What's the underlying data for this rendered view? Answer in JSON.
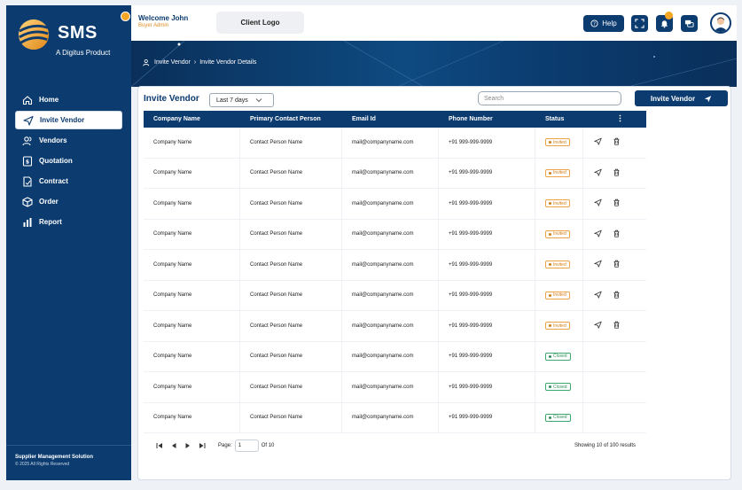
{
  "brand": {
    "title": "SMS",
    "subtitle": "A Digitus Product"
  },
  "sidebar": {
    "items": [
      {
        "label": "Home",
        "icon": "home-icon",
        "active": false
      },
      {
        "label": "Invite Vendor",
        "icon": "send-icon",
        "active": true
      },
      {
        "label": "Vendors",
        "icon": "users-icon",
        "active": false
      },
      {
        "label": "Quotation",
        "icon": "quotation-icon",
        "active": false
      },
      {
        "label": "Contract",
        "icon": "contract-icon",
        "active": false
      },
      {
        "label": "Order",
        "icon": "box-icon",
        "active": false
      },
      {
        "label": "Report",
        "icon": "chart-icon",
        "active": false
      }
    ],
    "footer_title": "Supplier Management Solution",
    "footer_copy": "© 2025 All Rights Reserved"
  },
  "topbar": {
    "welcome": "Welcome John",
    "role": "Buyer Admin",
    "client_logo": "Client Logo",
    "help_label": "Help"
  },
  "breadcrumb": {
    "item1": "Invite Vendor",
    "item2": "Invite Vendor Details"
  },
  "panel": {
    "title": "Invite Vendor",
    "range": "Last 7 days",
    "search_placeholder": "Search",
    "invite_button": "Invite Vendor"
  },
  "table": {
    "headers": [
      "Company Name",
      "Primary Contact Person",
      "Email Id",
      "Phone Number",
      "Status"
    ],
    "rows": [
      {
        "company": "Company Name",
        "contact": "Contact Person Name",
        "email": "mail@companyname.com",
        "phone": "+91 999-999-9999",
        "status": "Invited"
      },
      {
        "company": "Company Name",
        "contact": "Contact Person Name",
        "email": "mail@companyname.com",
        "phone": "+91 999-999-9999",
        "status": "Invited"
      },
      {
        "company": "Company Name",
        "contact": "Contact Person Name",
        "email": "mail@companyname.com",
        "phone": "+91 999-999-9999",
        "status": "Invited"
      },
      {
        "company": "Company Name",
        "contact": "Contact Person Name",
        "email": "mail@companyname.com",
        "phone": "+91 999-999-9999",
        "status": "Invited"
      },
      {
        "company": "Company Name",
        "contact": "Contact Person Name",
        "email": "mail@companyname.com",
        "phone": "+91 999-999-9999",
        "status": "Invited"
      },
      {
        "company": "Company Name",
        "contact": "Contact Person Name",
        "email": "mail@companyname.com",
        "phone": "+91 999-999-9999",
        "status": "Invited"
      },
      {
        "company": "Company Name",
        "contact": "Contact Person Name",
        "email": "mail@companyname.com",
        "phone": "+91 999-999-9999",
        "status": "Invited"
      },
      {
        "company": "Company Name",
        "contact": "Contact Person Name",
        "email": "mail@companyname.com",
        "phone": "+91 999-999-9999",
        "status": "Closed"
      },
      {
        "company": "Company Name",
        "contact": "Contact Person Name",
        "email": "mail@companyname.com",
        "phone": "+91 999-999-9999",
        "status": "Closed"
      },
      {
        "company": "Company Name",
        "contact": "Contact Person Name",
        "email": "mail@companyname.com",
        "phone": "+91 999-999-9999",
        "status": "Closed"
      }
    ]
  },
  "pager": {
    "page_label": "Page:",
    "page_value": "1",
    "of_label": "Of 10",
    "results": "Showing 10 of 100 results"
  },
  "colors": {
    "primary": "#0b3b6f",
    "accent": "#f5a623",
    "invited": "#d77a13",
    "closed": "#2f8f5b"
  }
}
